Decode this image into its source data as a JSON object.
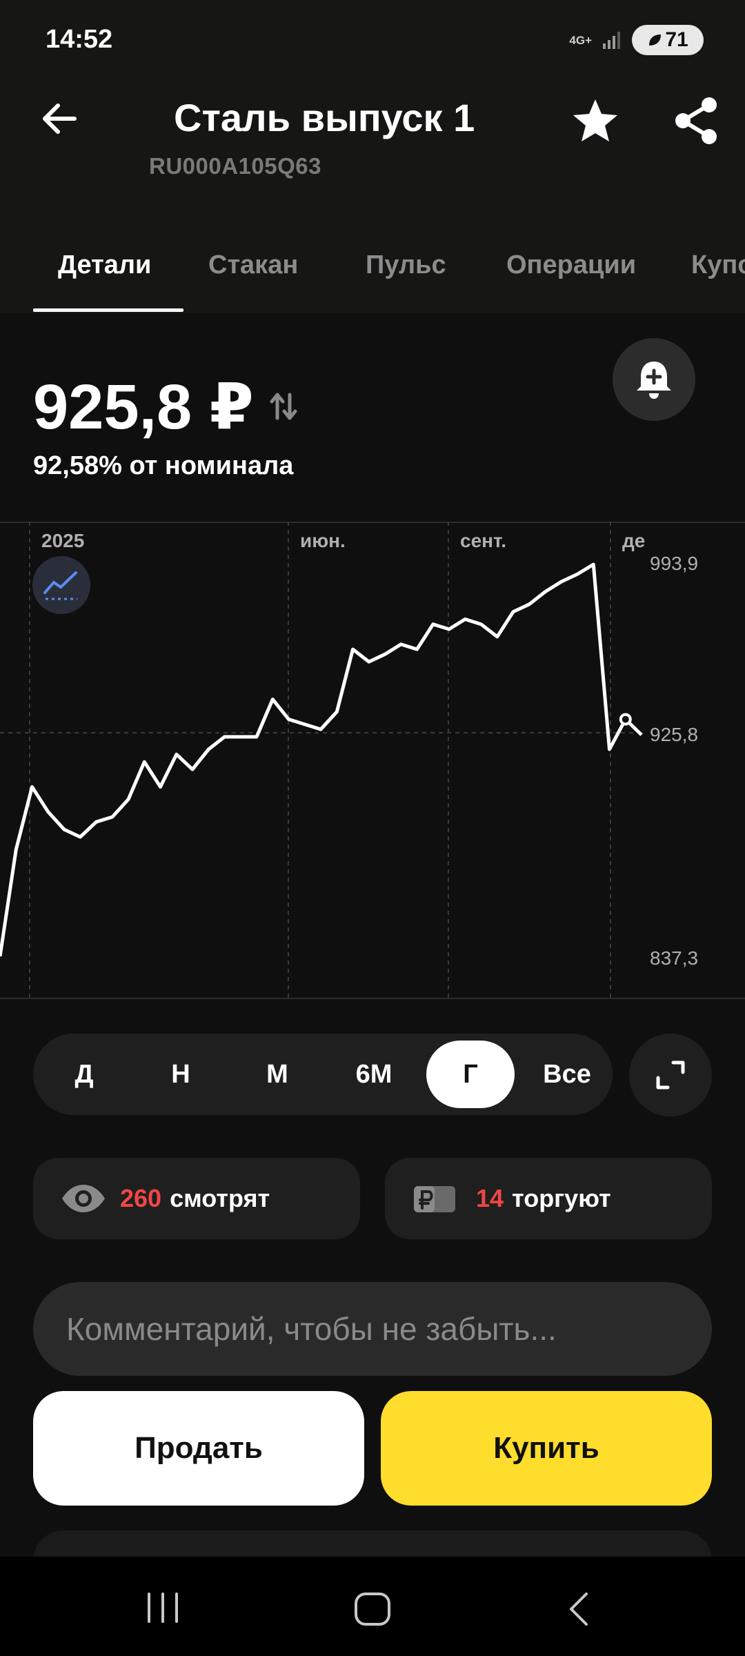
{
  "status_bar": {
    "time": "14:52",
    "network": "4G+",
    "battery": "71"
  },
  "header": {
    "title": "Сталь выпуск 1",
    "isin": "RU000A105Q63"
  },
  "tabs": [
    "Детали",
    "Стакан",
    "Пульс",
    "Операции",
    "Купо"
  ],
  "price": {
    "value": "925,8 ₽",
    "nominal_text": "92,58% от номинала"
  },
  "chart_data": {
    "type": "line",
    "x_tick_labels": [
      "2025",
      "июн.",
      "сент.",
      "де"
    ],
    "y_tick_labels": [
      "993,9",
      "925,8",
      "837,3"
    ],
    "ylim": [
      837.3,
      993.9
    ],
    "current_value": 925.8,
    "grid": true,
    "series": [
      {
        "values": [
          837.3,
          880,
          905,
          895,
          888,
          885,
          891,
          893,
          900,
          915,
          905,
          918,
          912,
          920,
          925,
          925,
          925,
          940,
          932,
          930,
          928,
          935,
          960,
          955,
          958,
          962,
          960,
          970,
          968,
          972,
          970,
          965,
          975,
          978,
          983,
          987,
          990,
          993.9,
          920,
          932,
          925.8
        ]
      }
    ],
    "line_color": "#ffffff"
  },
  "periods": [
    "Д",
    "Н",
    "М",
    "6М",
    "Г",
    "Все"
  ],
  "selected_period": "Г",
  "stats": {
    "watching_count": "260",
    "watching_label": "смотрят",
    "trading_count": "14",
    "trading_label": "торгуют"
  },
  "comment_placeholder": "Комментарий, чтобы не забыть...",
  "actions": {
    "sell": "Продать",
    "buy": "Купить"
  }
}
